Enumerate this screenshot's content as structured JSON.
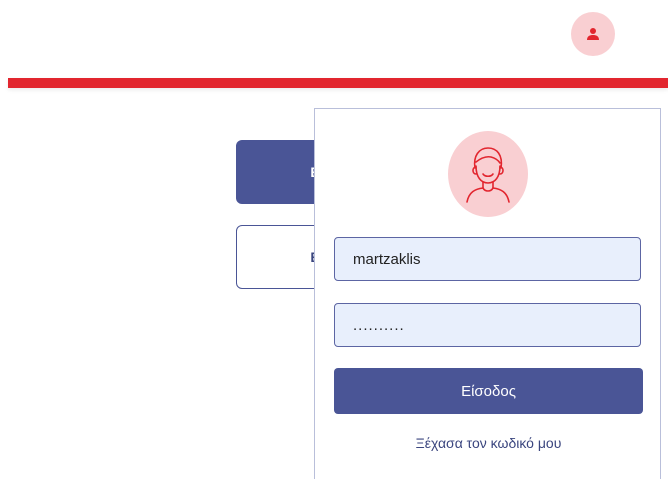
{
  "header": {
    "user_icon": "user-icon"
  },
  "background_buttons": {
    "primary_label": "ΕΙ",
    "secondary_label": "ΕΙ"
  },
  "login": {
    "avatar_icon": "user-avatar-icon",
    "username": {
      "value": "martzaklis"
    },
    "password": {
      "value": "..........",
      "masked": true
    },
    "submit_label": "Είσοδος",
    "forgot_label": "Ξέχασα τον κωδικό μου"
  },
  "colors": {
    "accent": "#4a5596",
    "header_bar": "#e2262f",
    "avatar_bg": "#f9cfd2",
    "input_bg": "#e8effc"
  }
}
